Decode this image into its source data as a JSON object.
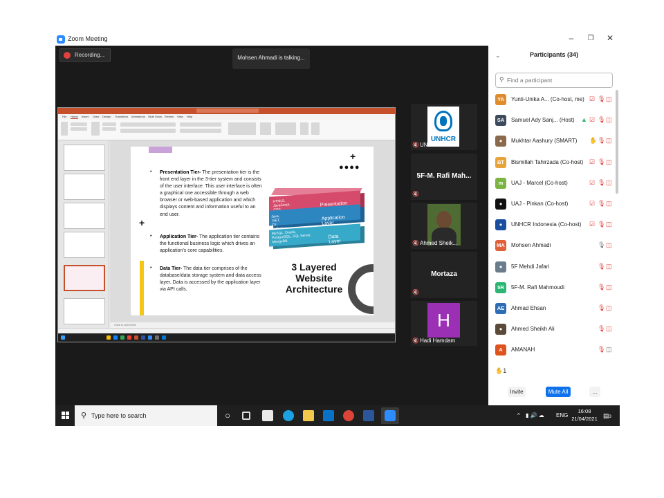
{
  "window": {
    "title": "Zoom Meeting",
    "minimize_icon": "minimize-icon",
    "restore_icon": "restore-icon",
    "close_icon": "close-icon"
  },
  "meeting": {
    "recording_label": "Recording...",
    "talking_label": "Mohsen Ahmadi is talking..."
  },
  "slide": {
    "tiers": [
      {
        "title": "Presentation Tier-",
        "text": " The presentation tier is the front end layer in the 3-tier system and consists of the user interface. This user interface is often a graphical one accessible through a web browser or web-based application and which displays content and information useful to an end user."
      },
      {
        "title": "Application Tier-",
        "text": " The application tier contains the functional business logic which drives an application's core capabilities."
      },
      {
        "title": "Data Tier-",
        "text": " The data tier comprises of the database/data storage system and data access layer. Data is accessed by the application layer via API calls."
      }
    ],
    "layers": [
      {
        "tech": "HTML5, JavaScript, CSS",
        "name": "Presentation Layer",
        "color": "#d64b6b",
        "side": "#a8354f"
      },
      {
        "tech": "Java, .NET, C#, Python, C++",
        "name": "Application Layer",
        "color": "#2e86c1",
        "side": "#1f6394"
      },
      {
        "tech": "MySQL, Oracle, PostgreSQL, SQL Server, MongoDB",
        "name": "Data Layer",
        "color": "#37a9c9",
        "side": "#2a7f99"
      }
    ],
    "title_lines": [
      "3 Layered",
      "Website",
      "Architecture"
    ],
    "notes_placeholder": "Click to add notes"
  },
  "gallery": [
    {
      "name": "UNHCR Indo...",
      "type": "logo",
      "logo_text": "UNHCR"
    },
    {
      "name": "5F-M. Rafi Mah...",
      "type": "name"
    },
    {
      "name": "Ahmed Sheik...",
      "type": "photo"
    },
    {
      "name": "Mortaza",
      "type": "name"
    },
    {
      "name": "Hadi Hamdam",
      "type": "initial",
      "initial": "H"
    }
  ],
  "participants_panel": {
    "title": "Participants (34)",
    "search_placeholder": "Find a participant",
    "participants": [
      {
        "initials": "YA",
        "color": "#e08c2c",
        "name": "Yunti-Unika A... (Co-host, me)",
        "icons": [
          "share-icon",
          "mic-muted-icon",
          "video-off-icon"
        ]
      },
      {
        "initials": "SA",
        "color": "#3d4a5c",
        "name": "Samuel Ady Sanj... (Host)",
        "icons": [
          "screen-share-icon",
          "share-icon",
          "mic-muted-icon",
          "video-off-icon"
        ]
      },
      {
        "initials": "",
        "color": "#8a6a4a",
        "name": "Mukhtar Aashury (SMART)",
        "icons": [
          "raised-hand-icon",
          "mic-muted-icon",
          "video-off-icon"
        ]
      },
      {
        "initials": "BT",
        "color": "#e8a23a",
        "name": "Bismillah Tahirzada (Co-host)",
        "icons": [
          "share-icon",
          "mic-muted-icon",
          "video-off-icon"
        ]
      },
      {
        "initials": "m",
        "color": "#7cb342",
        "name": "UAJ - Marcel (Co-host)",
        "icons": [
          "share-icon",
          "mic-muted-icon",
          "video-off-icon"
        ]
      },
      {
        "initials": "",
        "color": "#111111",
        "name": "UAJ - Pinkan (Co-host)",
        "icons": [
          "share-icon",
          "mic-muted-icon",
          "video-off-icon"
        ]
      },
      {
        "initials": "",
        "color": "#1a4fa0",
        "name": "UNHCR Indonesia (Co-host)",
        "icons": [
          "share-icon",
          "mic-muted-icon",
          "video-off-icon"
        ]
      },
      {
        "initials": "MA",
        "color": "#e0603a",
        "name": "Mohsen Ahmadi",
        "icons": [
          "mic-on-icon",
          "video-off-icon"
        ]
      },
      {
        "initials": "",
        "color": "#6b7c8c",
        "name": "5F Mehdi Jafari",
        "icons": [
          "mic-muted-icon",
          "video-off-icon"
        ]
      },
      {
        "initials": "5R",
        "color": "#2bb673",
        "name": "5F-M. Rafi Mahmoudi",
        "icons": [
          "mic-muted-icon",
          "video-off-icon"
        ]
      },
      {
        "initials": "AE",
        "color": "#2d6db5",
        "name": "Ahmad Ehsan",
        "icons": [
          "mic-muted-icon",
          "video-off-icon"
        ]
      },
      {
        "initials": "",
        "color": "#5b4a3a",
        "name": "Ahmed Sheikh Ali",
        "icons": [
          "mic-muted-icon",
          "video-off-icon"
        ]
      },
      {
        "initials": "A",
        "color": "#e0531f",
        "name": "AMANAH",
        "icons": [
          "mic-muted-icon",
          "video-icon"
        ]
      }
    ],
    "raised_hands_count": "1",
    "invite_label": "Invite",
    "mute_all_label": "Mute All",
    "more_label": "..."
  },
  "taskbar": {
    "search_placeholder": "Type here to search",
    "language": "ENG",
    "time": "16:08",
    "date": "21/04/2021",
    "notification_count": "3"
  }
}
